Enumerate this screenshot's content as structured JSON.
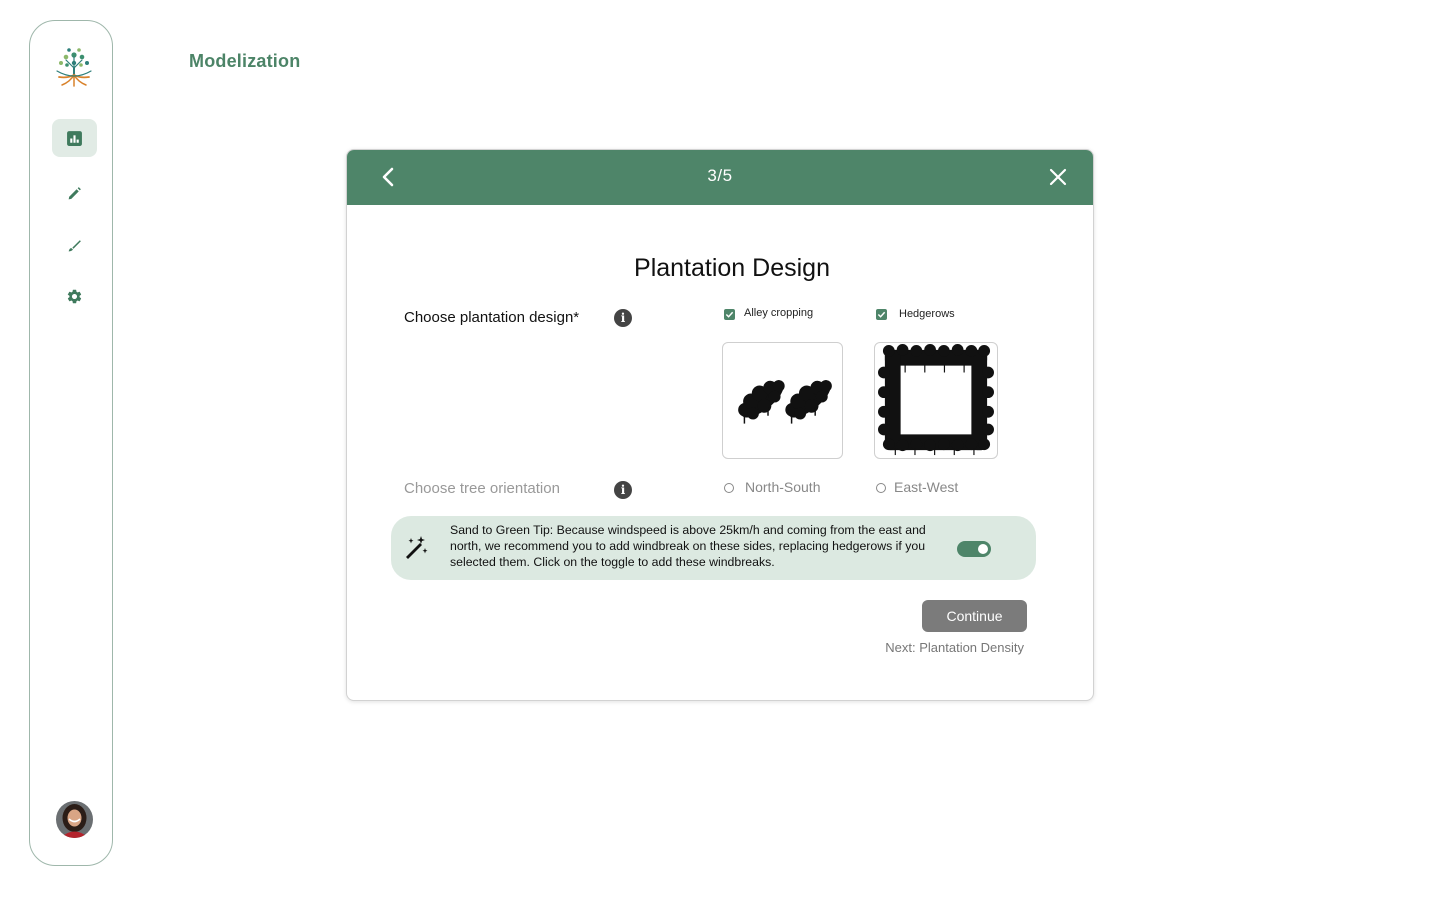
{
  "page": {
    "title": "Modelization"
  },
  "sidebar": {
    "items": [
      {
        "icon": "chart-icon",
        "active": true
      },
      {
        "icon": "pencil-icon",
        "active": false
      },
      {
        "icon": "brush-icon",
        "active": false
      },
      {
        "icon": "gear-icon",
        "active": false
      }
    ]
  },
  "modal": {
    "step": "3/5",
    "title": "Plantation Design",
    "design": {
      "label": "Choose plantation design*",
      "info": "i",
      "options": [
        {
          "label": "Alley cropping",
          "checked": true
        },
        {
          "label": "Hedgerows",
          "checked": true
        }
      ]
    },
    "orientation": {
      "label": "Choose tree orientation",
      "info": "i",
      "options": [
        {
          "label": "North-South",
          "selected": false
        },
        {
          "label": "East-West",
          "selected": false
        }
      ]
    },
    "tip": {
      "text": "Sand to Green Tip: Because windspeed is above 25km/h and coming from the east and north, we recommend you to add windbreak on these sides, replacing hedgerows if you selected them. Click on the toggle to add these windbreaks.",
      "toggle_on": true
    },
    "continue_label": "Continue",
    "next_text": "Next: Plantation Density"
  },
  "colors": {
    "brand": "#4e8569",
    "tip_bg": "#dce9e1",
    "button_gray": "#7b7b7b"
  }
}
